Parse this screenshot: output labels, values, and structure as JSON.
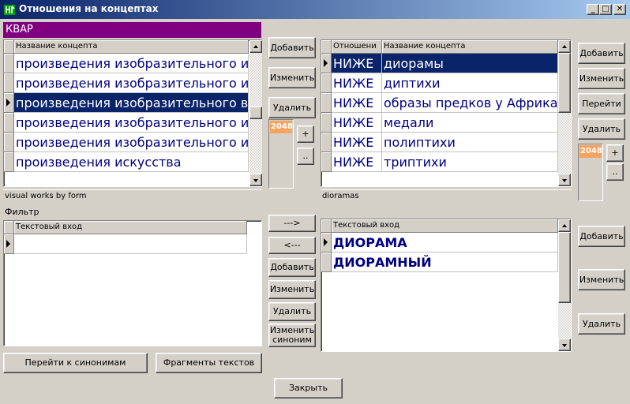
{
  "window": {
    "title": "Отношения на концептах",
    "minimize": "_",
    "maximize": "□",
    "close": "✕"
  },
  "left_panel": {
    "header_label": "КВАР",
    "grid_column": "Название концепта",
    "rows": [
      "произведения изобразительного и",
      "произведения изобразительного и",
      "произведения изобразительного в",
      "произведения изобразительного и",
      "произведения изобразительного и",
      "произведения искусства"
    ],
    "selected_row": 2,
    "caption": "visual works by form"
  },
  "middle_buttons": {
    "add": "Добавить",
    "edit": "Изменить",
    "delete": "Удалить",
    "counter": "2048",
    "plus": "+",
    "minus": ".."
  },
  "right_panel": {
    "columns": [
      "Отношени",
      "Название концепта"
    ],
    "rows": [
      {
        "rel": "НИЖЕ",
        "name": "диорамы"
      },
      {
        "rel": "НИЖЕ",
        "name": "диптихи"
      },
      {
        "rel": "НИЖЕ",
        "name": "образы предков у Африка"
      },
      {
        "rel": "НИЖЕ",
        "name": "медали"
      },
      {
        "rel": "НИЖЕ",
        "name": "полиптихи"
      },
      {
        "rel": "НИЖЕ",
        "name": "триптихи"
      }
    ],
    "selected_row": 0,
    "caption": "dioramas"
  },
  "right_buttons": {
    "add": "Добавить",
    "edit": "Изменить",
    "goto": "Перейти",
    "delete": "Удалить",
    "counter": "2048",
    "plus": "+",
    "minus": ".."
  },
  "filter": {
    "label": "Фильтр",
    "column": "Текстовый вход",
    "value": ""
  },
  "transfer_buttons": {
    "to_right": "--->",
    "to_left": "<---",
    "add": "Добавить",
    "edit": "Изменить",
    "delete": "Удалить",
    "change_synonym": "Изменить синоним"
  },
  "text_entries": {
    "column": "Текстовый вход",
    "rows": [
      "ДИОРАМА",
      "ДИОРАМНЫЙ"
    ]
  },
  "text_entry_buttons": {
    "add": "Добавить",
    "edit": "Изменить",
    "delete": "Удалить"
  },
  "bottom": {
    "goto_synonyms": "Перейти к синонимам",
    "text_fragments": "Фрагменты текстов",
    "close": "Закрыть"
  }
}
